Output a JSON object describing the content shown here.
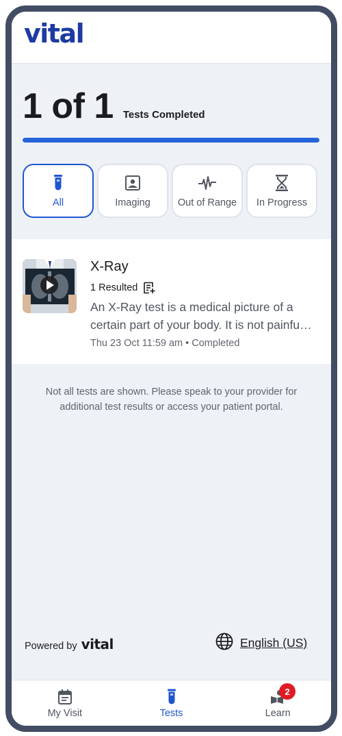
{
  "header": {
    "logo": "vital"
  },
  "progress": {
    "count": "1 of 1",
    "label": "Tests Completed",
    "fraction": 1.0
  },
  "filters": [
    {
      "label": "All",
      "icon": "test-tube-icon",
      "active": true
    },
    {
      "label": "Imaging",
      "icon": "image-portrait-icon",
      "active": false
    },
    {
      "label": "Out of Range",
      "icon": "pulse-icon",
      "active": false
    },
    {
      "label": "In Progress",
      "icon": "hourglass-icon",
      "active": false
    }
  ],
  "test": {
    "title": "X-Ray",
    "resulted": "1 Resulted",
    "description": "An X-Ray test is a medical picture of a certain part of your body. It is not painfu…",
    "meta": "Thu 23 Oct 11:59 am • Completed"
  },
  "notice": "Not all tests are shown. Please speak to your provider for additional test results or access your patient portal.",
  "footer": {
    "powered_by": "Powered by",
    "powered_logo": "vital",
    "language": "English (US)"
  },
  "tabs": [
    {
      "label": "My Visit",
      "icon": "calendar-icon",
      "active": false
    },
    {
      "label": "Tests",
      "icon": "test-tube-icon",
      "active": true
    },
    {
      "label": "Learn",
      "icon": "person-book-icon",
      "active": false,
      "badge": "2"
    }
  ],
  "colors": {
    "brand": "#1d3aa3",
    "accent": "#2563db",
    "badge": "#e01b24",
    "frame": "#424d64"
  }
}
